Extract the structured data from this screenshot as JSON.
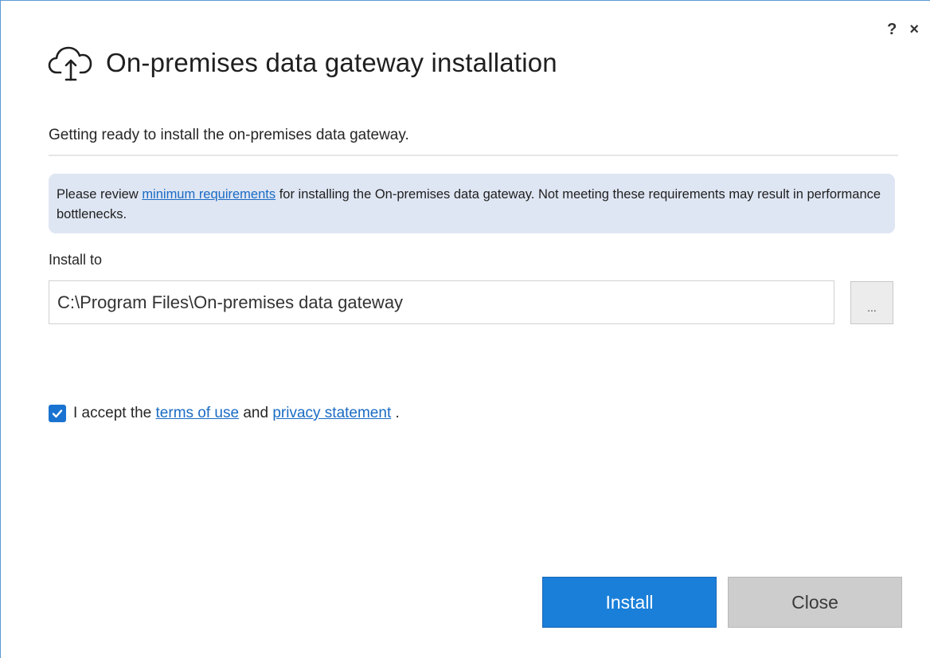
{
  "window_controls": {
    "help": "?",
    "close": "×"
  },
  "header": {
    "icon": "cloud-upload-icon",
    "title": "On-premises data gateway installation"
  },
  "subtitle": "Getting ready to install the on-premises data gateway.",
  "notice": {
    "prefix": "Please review ",
    "link": "minimum requirements",
    "suffix": " for installing the On-premises data gateway. Not meeting these requirements may result in performance bottlenecks."
  },
  "install_to": {
    "label": "Install to",
    "path": "C:\\Program Files\\On-premises data gateway",
    "browse_label": "..."
  },
  "terms": {
    "checked": true,
    "prefix": "I accept the ",
    "terms_link": "terms of use",
    "middle": " and ",
    "privacy_link": "privacy statement",
    "suffix": " ."
  },
  "buttons": {
    "install": "Install",
    "close": "Close"
  },
  "colors": {
    "accent": "#1a7fd9",
    "link": "#1a6bc4",
    "notice_bg": "#dfe6f3"
  }
}
